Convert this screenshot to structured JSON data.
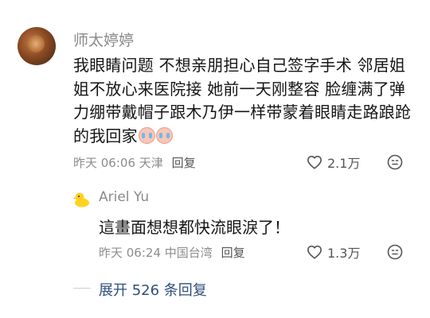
{
  "comment": {
    "username": "师太婷婷",
    "text": "我眼睛问题 不想亲朋担心自己签字手术 邻居姐姐不放心来医院接 她前一天刚整容 脸缠满了弹力绷带戴帽子跟木乃伊一样带蒙着眼睛走路踉跄的我回家",
    "time": "昨天 06:06",
    "location": "天津",
    "reply_label": "回复",
    "likes": "2.1万"
  },
  "reply": {
    "username": "Ariel Yu",
    "text": "這畫面想想都快流眼淚了！",
    "time": "昨天 06:24",
    "location": "中国台湾",
    "reply_label": "回复",
    "likes": "1.3万"
  },
  "expand_label": "展开 526 条回复",
  "icons": {
    "like": "heart-outline-icon",
    "emoji": "emoji-face-icon",
    "crying_emoji": "crying-face-emoji"
  }
}
